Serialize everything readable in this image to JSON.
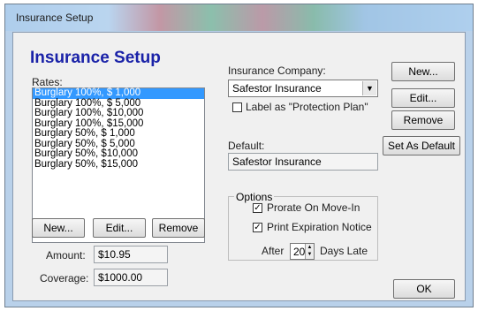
{
  "window": {
    "title": "Insurance Setup"
  },
  "heading": "Insurance Setup",
  "rates": {
    "label": "Rates:",
    "items": [
      "Burglary 100%, $ 1,000",
      "Burglary 100%, $ 5,000",
      "Burglary 100%, $10,000",
      "Burglary 100%, $15,000",
      "Burglary 50%, $ 1,000",
      "Burglary 50%, $ 5,000",
      "Burglary 50%, $10,000",
      "Burglary 50%, $15,000"
    ],
    "selected_index": 0
  },
  "rate_buttons": {
    "new": "New...",
    "edit": "Edit...",
    "remove": "Remove"
  },
  "amount": {
    "label": "Amount:",
    "value": "$10.95"
  },
  "coverage": {
    "label": "Coverage:",
    "value": "$1000.00"
  },
  "company": {
    "label": "Insurance Company:",
    "selected": "Safestor Insurance",
    "protection_plan_label": "Label as \"Protection Plan\"",
    "protection_plan_checked": false
  },
  "default": {
    "label": "Default:",
    "value": "Safestor Insurance"
  },
  "company_buttons": {
    "new": "New...",
    "edit": "Edit...",
    "remove": "Remove",
    "set_default": "Set As Default"
  },
  "options": {
    "title": "Options",
    "prorate_label": "Prorate On Move-In",
    "prorate_checked": true,
    "print_label": "Print Expiration Notice",
    "print_checked": true,
    "after_label": "After",
    "days_value": "20",
    "days_label": "Days Late"
  },
  "ok_label": "OK"
}
